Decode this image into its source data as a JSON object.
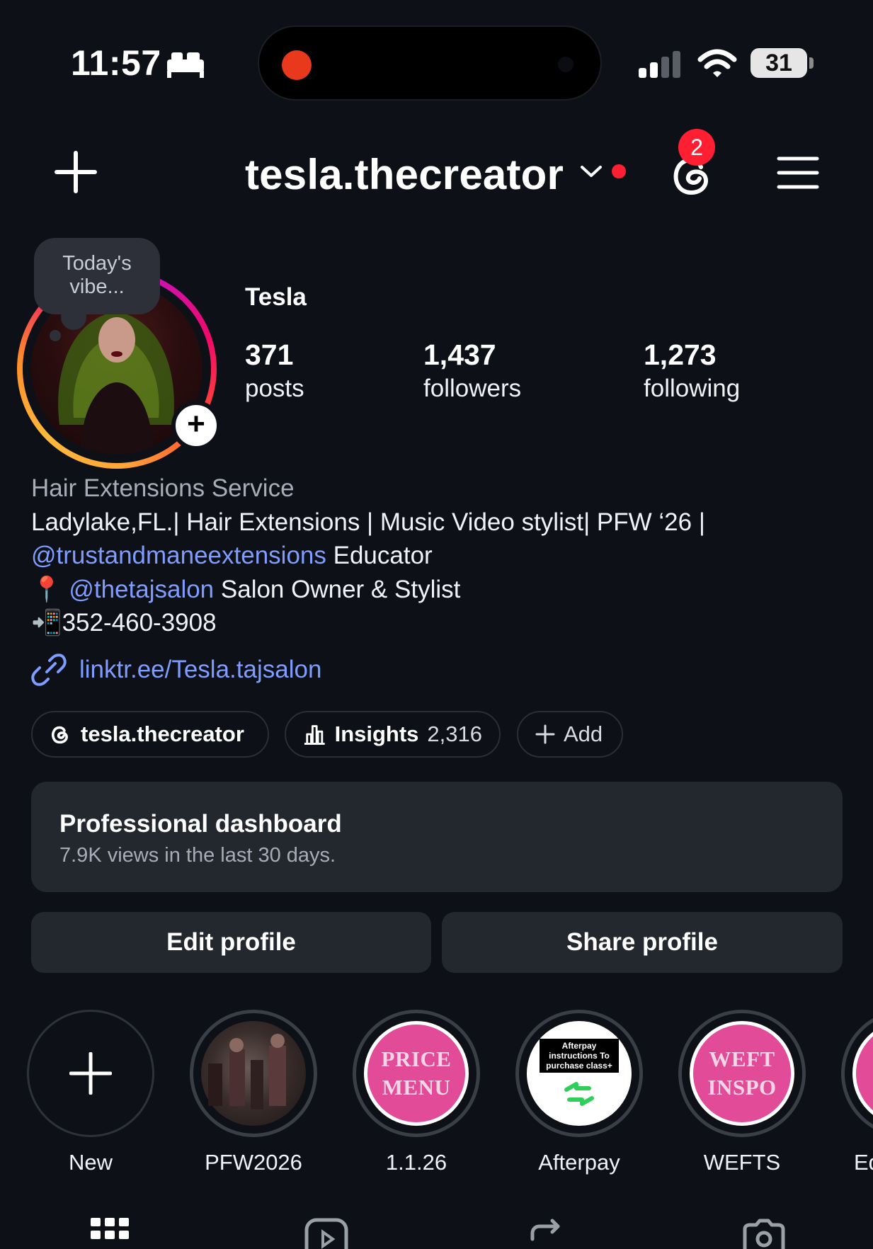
{
  "status_bar": {
    "time": "11:57",
    "battery": "31"
  },
  "header": {
    "username": "tesla.thecreator",
    "notification_count": "2"
  },
  "profile": {
    "note": "Today's vibe...",
    "display_name": "Tesla",
    "stats": [
      {
        "value": "371",
        "label": "posts"
      },
      {
        "value": "1,437",
        "label": "followers"
      },
      {
        "value": "1,273",
        "label": "following"
      }
    ]
  },
  "bio": {
    "category": "Hair Extensions Service",
    "line1": "Ladylake,FL.| Hair Extensions | Music Video stylist| PFW ‘26 |",
    "mention1": "@trustandmaneextensions",
    "line2_rest": " Educator",
    "pin_emoji": "📍",
    "mention2": "@thetajsalon",
    "line3_rest": " Salon Owner & Stylist",
    "phone_emoji": "📲",
    "phone": "352-460-3908",
    "link": "linktr.ee/Tesla.tajsalon"
  },
  "chips": {
    "threads_label": "tesla.thecreator",
    "insights_label": "Insights",
    "insights_count": "2,316",
    "add_label": "Add"
  },
  "dashboard": {
    "title": "Professional dashboard",
    "subtitle": "7.9K views in the last 30 days."
  },
  "actions": {
    "edit": "Edit profile",
    "share": "Share profile"
  },
  "highlights": {
    "new_label": "New",
    "items": [
      {
        "label": "PFW2026"
      },
      {
        "label": "1.1.26",
        "cover_text": "PRICE MENU"
      },
      {
        "label": "Afterpay",
        "cover_text": "Afterpay instructions To purchase class+"
      },
      {
        "label": "WEFTS",
        "cover_text": "WEFT INSPO"
      },
      {
        "label": "Ed"
      }
    ]
  },
  "colors": {
    "accent_link": "#7f9cff",
    "badge_red": "#ff1f33",
    "bg": "#0d1016",
    "card": "#23272e"
  }
}
